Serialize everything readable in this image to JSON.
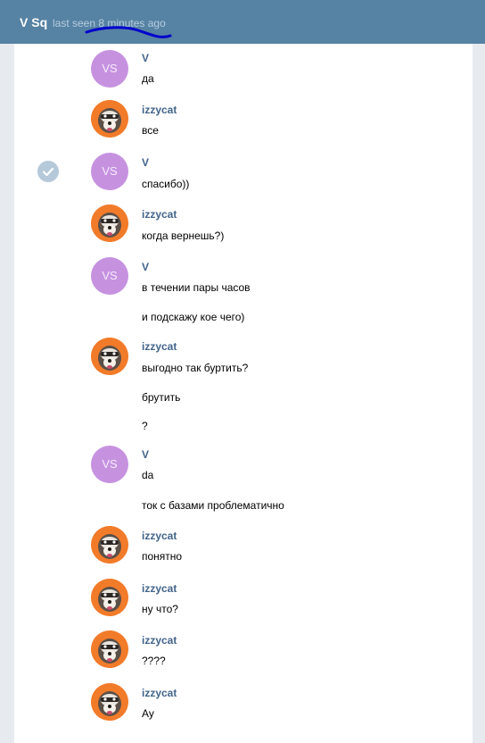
{
  "header": {
    "name": "V Sq",
    "status": "last seen 8 minutes ago"
  },
  "avatars": {
    "v_initials": "VS",
    "izzy_icon": "raccoon-avatar-icon"
  },
  "messages": [
    {
      "author": "V",
      "avatar": "initials",
      "lines": [
        "да"
      ]
    },
    {
      "author": "izzycat",
      "avatar": "photo",
      "lines": [
        "все"
      ]
    },
    {
      "author": "V",
      "avatar": "initials",
      "lines": [
        "спасибо))"
      ]
    },
    {
      "author": "izzycat",
      "avatar": "photo",
      "lines": [
        "когда вернешь?)"
      ]
    },
    {
      "author": "V",
      "avatar": "initials",
      "lines": [
        "в течении пары часов",
        "и подскажу кое чего)"
      ]
    },
    {
      "author": "izzycat",
      "avatar": "photo",
      "lines": [
        "выгодно так буртить?",
        "брутить",
        "?"
      ]
    },
    {
      "author": "V",
      "avatar": "initials",
      "lines": [
        "da",
        "ток с базами проблематично"
      ]
    },
    {
      "author": "izzycat",
      "avatar": "photo",
      "lines": [
        "понятно"
      ]
    },
    {
      "author": "izzycat",
      "avatar": "photo",
      "lines": [
        "ну что?"
      ]
    },
    {
      "author": "izzycat",
      "avatar": "photo",
      "lines": [
        "????"
      ]
    },
    {
      "author": "izzycat",
      "avatar": "photo",
      "lines": [
        "Ау"
      ]
    }
  ],
  "colors": {
    "header_bg": "#5682a3",
    "author": "#42648b",
    "initials_avatar": "#c692e0",
    "scribble": "#0000cc"
  }
}
